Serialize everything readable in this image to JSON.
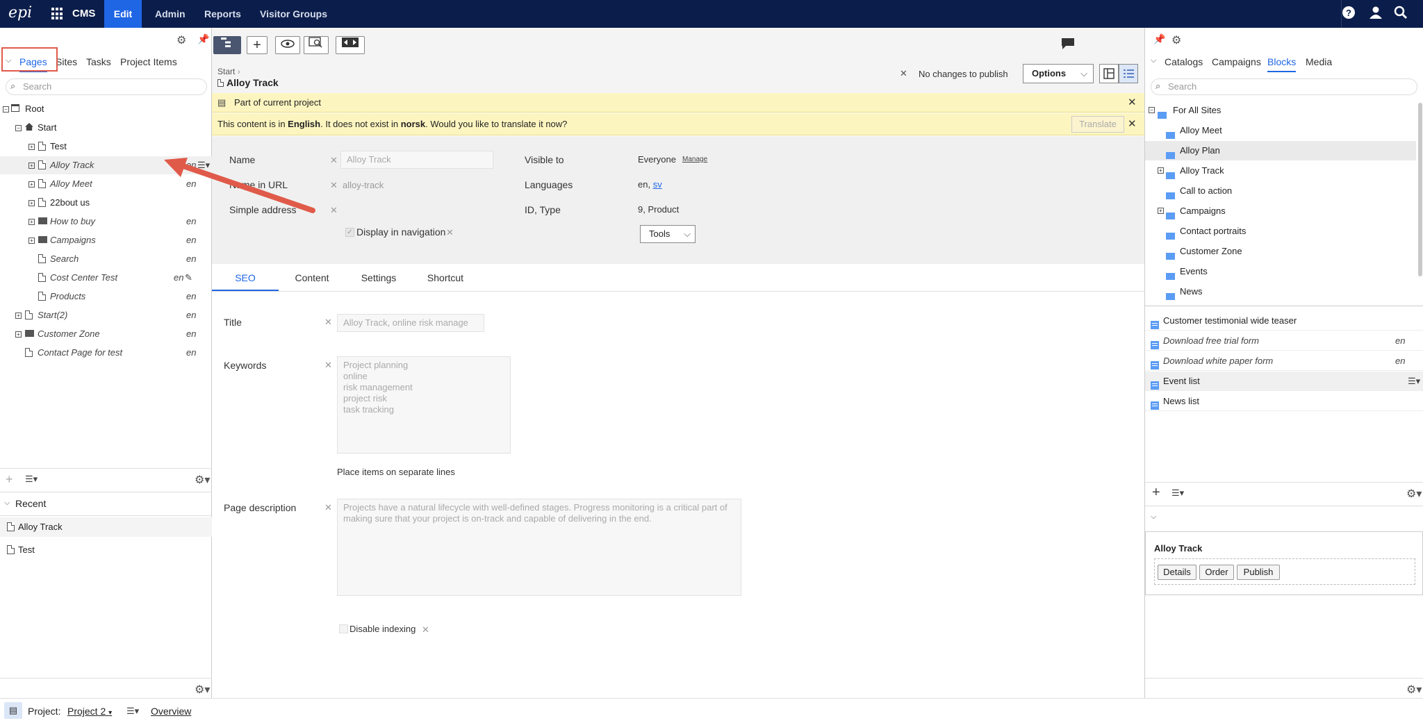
{
  "topnav": {
    "logo": "epi",
    "product": "CMS",
    "items": [
      "Edit",
      "Admin",
      "Reports",
      "Visitor Groups"
    ]
  },
  "left": {
    "tabs": [
      "Pages",
      "Sites",
      "Tasks",
      "Project Items"
    ],
    "search_placeholder": "Search",
    "tree": [
      {
        "label": "Root",
        "lang": ""
      },
      {
        "label": "Start",
        "lang": ""
      },
      {
        "label": "Test",
        "lang": ""
      },
      {
        "label": "Alloy Track",
        "lang": "en"
      },
      {
        "label": "Alloy Meet",
        "lang": "en"
      },
      {
        "label": "22bout us",
        "lang": ""
      },
      {
        "label": "How to buy",
        "lang": "en"
      },
      {
        "label": "Campaigns",
        "lang": "en"
      },
      {
        "label": "Search",
        "lang": "en"
      },
      {
        "label": "Cost Center Test",
        "lang": "en"
      },
      {
        "label": "Products",
        "lang": "en"
      },
      {
        "label": "Start(2)",
        "lang": "en"
      },
      {
        "label": "Customer Zone",
        "lang": "en"
      },
      {
        "label": "Contact Page for test",
        "lang": "en"
      }
    ],
    "recent_label": "Recent",
    "recent": [
      "Alloy Track",
      "Test"
    ]
  },
  "center": {
    "breadcrumb": "Start",
    "title": "Alloy Track",
    "publish_status": "No changes to publish",
    "options_label": "Options",
    "banner1": "Part of current project",
    "banner2": {
      "pre": "This content is in ",
      "lang1": "English",
      "mid": ". It does not exist in ",
      "lang2": "norsk",
      "post": ". Would you like to translate it now?"
    },
    "translate_label": "Translate",
    "fields": {
      "name_label": "Name",
      "name_value": "Alloy Track",
      "url_label": "Name in URL",
      "url_value": "alloy-track",
      "simple_label": "Simple address",
      "display_nav": "Display in navigation",
      "visible_label": "Visible to",
      "visible_value": "Everyone",
      "manage": "Manage",
      "languages_label": "Languages",
      "languages_en": "en,",
      "languages_sv": "sv",
      "idtype_label": "ID, Type",
      "idtype_value": "9, Product",
      "tools_label": "Tools"
    },
    "tabs": [
      "SEO",
      "Content",
      "Settings",
      "Shortcut"
    ],
    "seo": {
      "title_label": "Title",
      "title_value": "Alloy Track, online risk manage",
      "keywords_label": "Keywords",
      "keywords_lines": [
        "Project planning",
        "online",
        "risk management",
        "project risk",
        "task tracking"
      ],
      "keywords_hint": "Place items on separate lines",
      "desc_label": "Page description",
      "desc_value": "Projects have a natural lifecycle with well-defined stages. Progress monitoring is a critical part of making sure that your project is on-track and capable of delivering in the end.",
      "disable_indexing": "Disable indexing"
    }
  },
  "right": {
    "tabs": [
      "Catalogs",
      "Campaigns",
      "Blocks",
      "Media"
    ],
    "search_placeholder": "Search",
    "folders": [
      "For All Sites",
      "Alloy Meet",
      "Alloy Plan",
      "Alloy Track",
      "Call to action",
      "Campaigns",
      "Contact portraits",
      "Customer Zone",
      "Events",
      "News"
    ],
    "blocks": [
      {
        "label": "Customer testimonial wide teaser",
        "lang": ""
      },
      {
        "label": "Download free trial form",
        "lang": "en"
      },
      {
        "label": "Download white paper form",
        "lang": "en"
      },
      {
        "label": "Event list",
        "lang": ""
      },
      {
        "label": "News list",
        "lang": ""
      }
    ],
    "cart_title": "Alloy Track",
    "cart_buttons": [
      "Details",
      "Order",
      "Publish"
    ]
  },
  "bottom": {
    "project_label": "Project:",
    "project_name": "Project 2",
    "overview": "Overview"
  }
}
